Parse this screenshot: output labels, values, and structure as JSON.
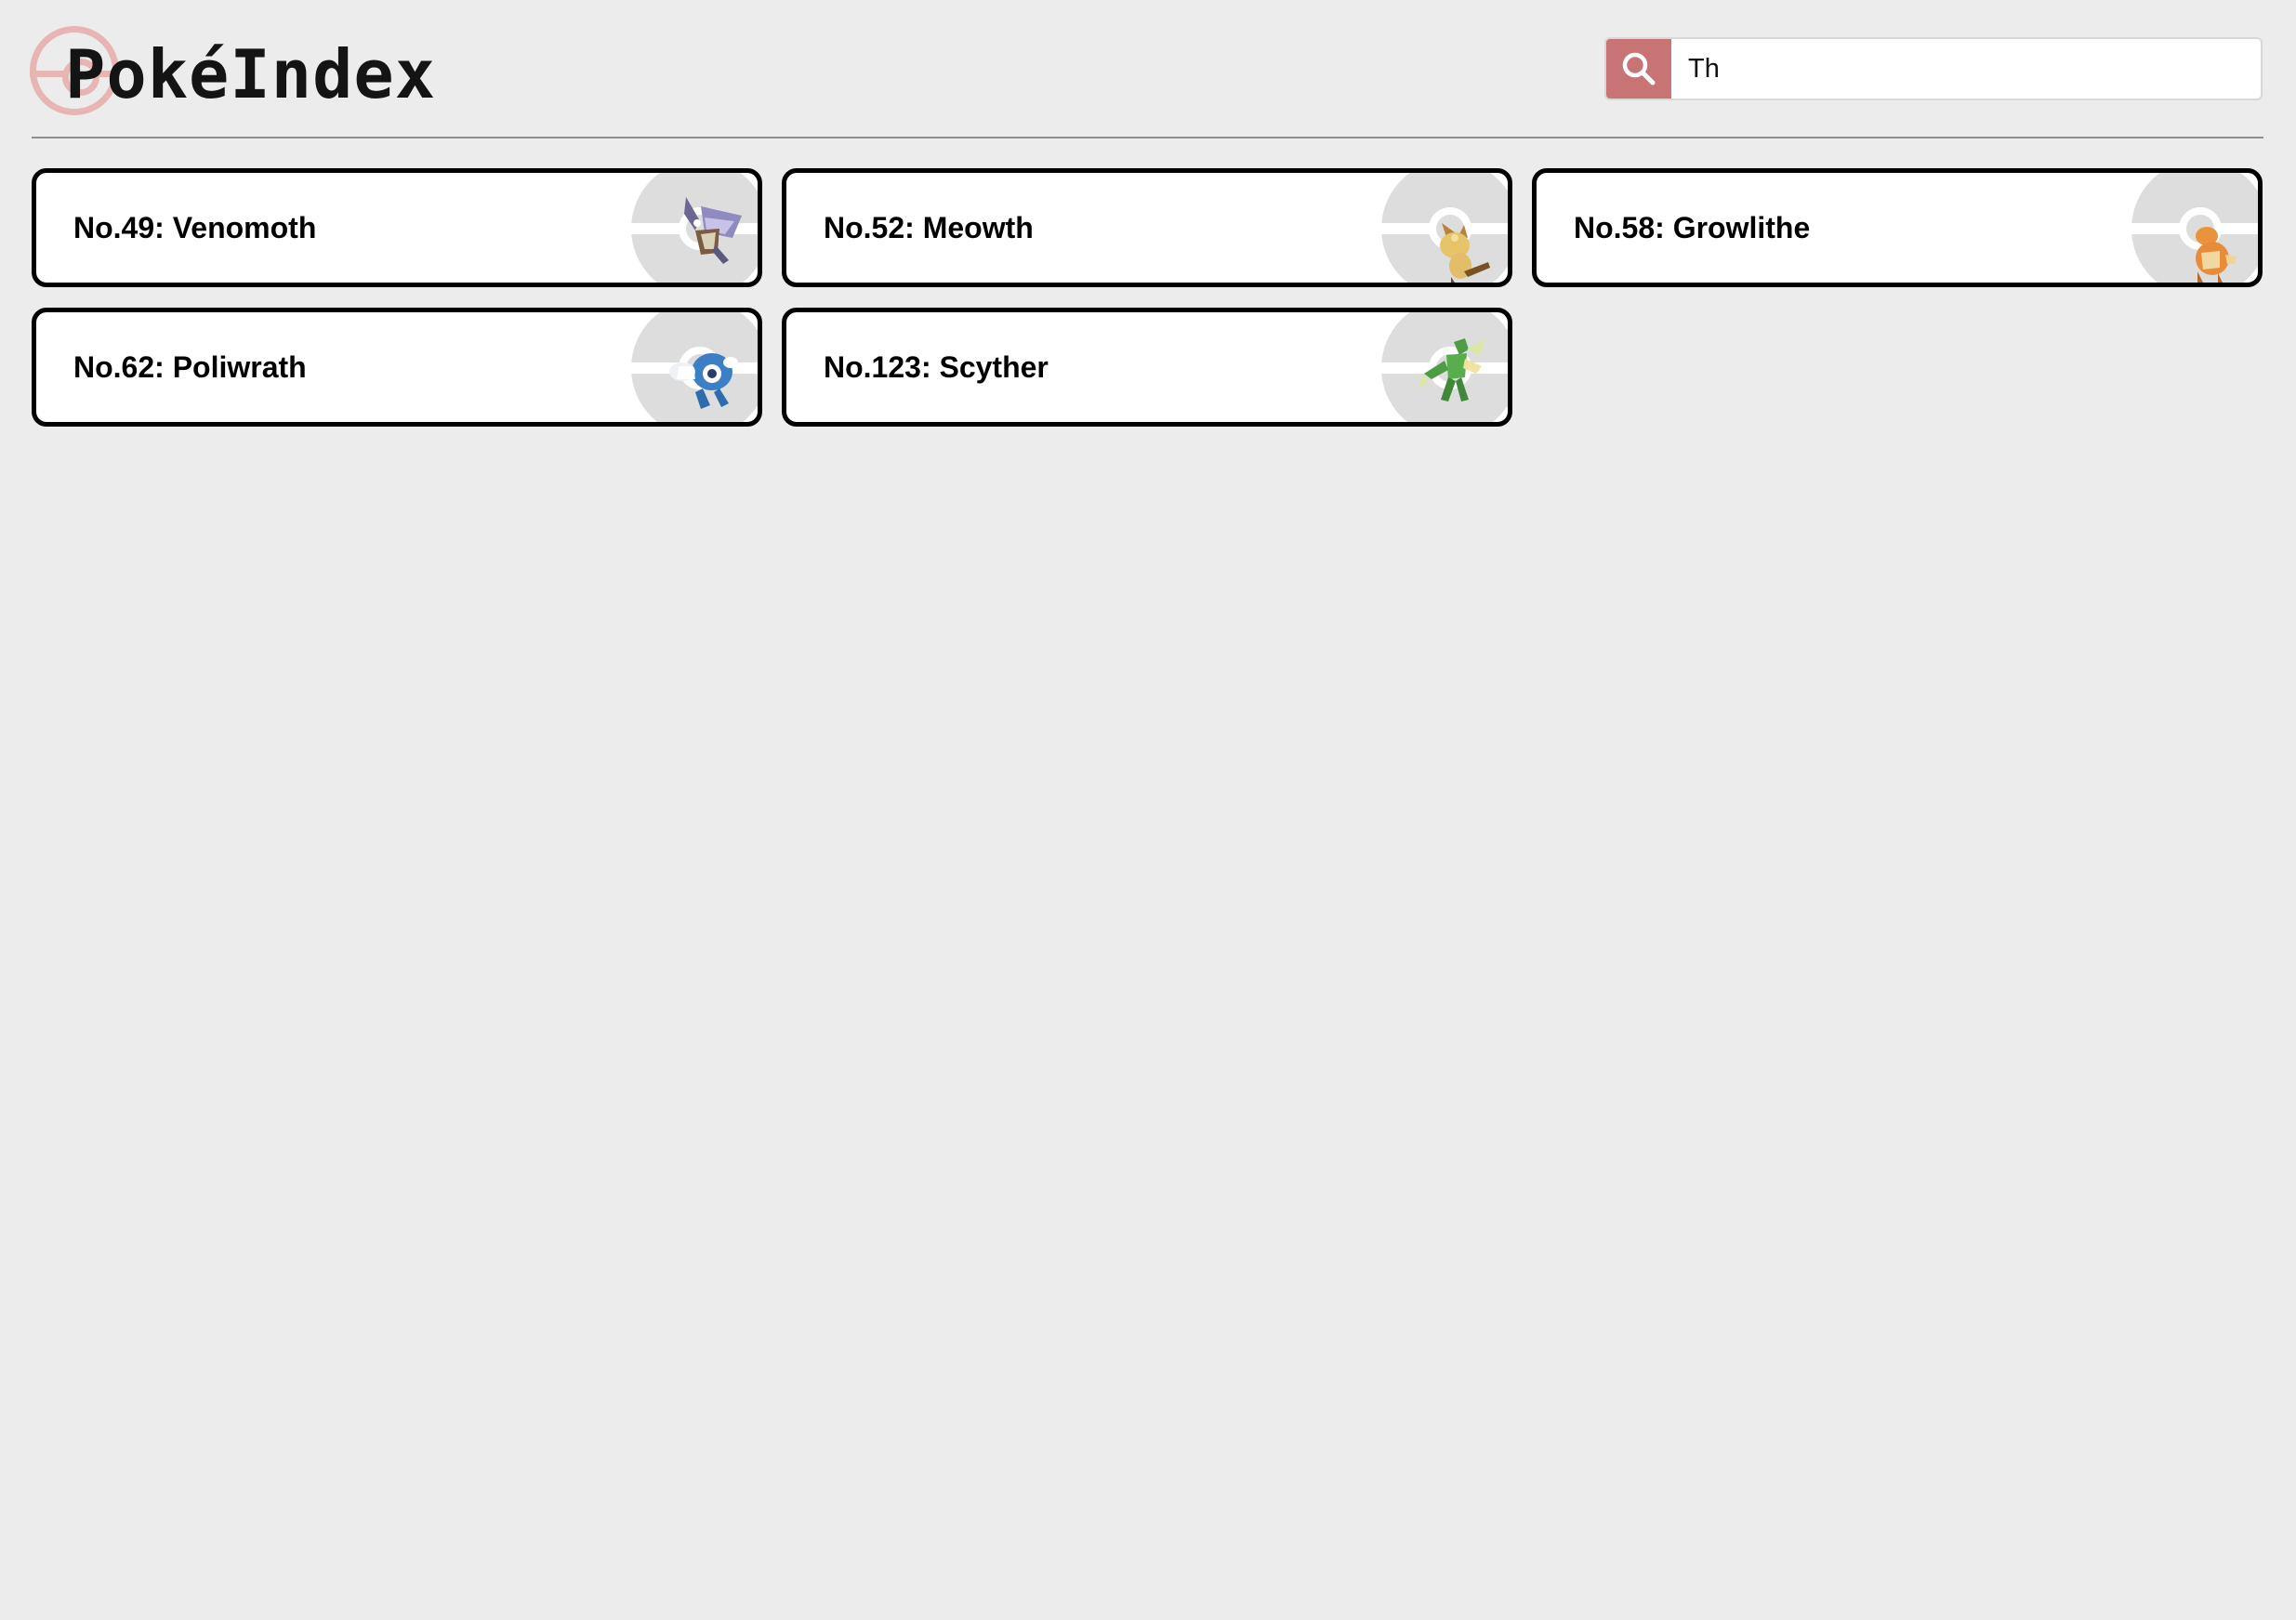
{
  "header": {
    "logo_text": "PokéIndex"
  },
  "search": {
    "value": "Th",
    "icon": "search-icon"
  },
  "results": [
    {
      "label": "No.49: Venomoth",
      "sprite": "venomoth-sprite"
    },
    {
      "label": "No.52: Meowth",
      "sprite": "meowth-sprite"
    },
    {
      "label": "No.58: Growlithe",
      "sprite": "growlithe-sprite"
    },
    {
      "label": "No.62: Poliwrath",
      "sprite": "poliwrath-sprite"
    },
    {
      "label": "No.123: Scyther",
      "sprite": "scyther-sprite"
    }
  ],
  "colors": {
    "background": "#ececec",
    "accent": "#c97474",
    "logo_ball": "#e8b5b5",
    "card_border": "#000000"
  }
}
